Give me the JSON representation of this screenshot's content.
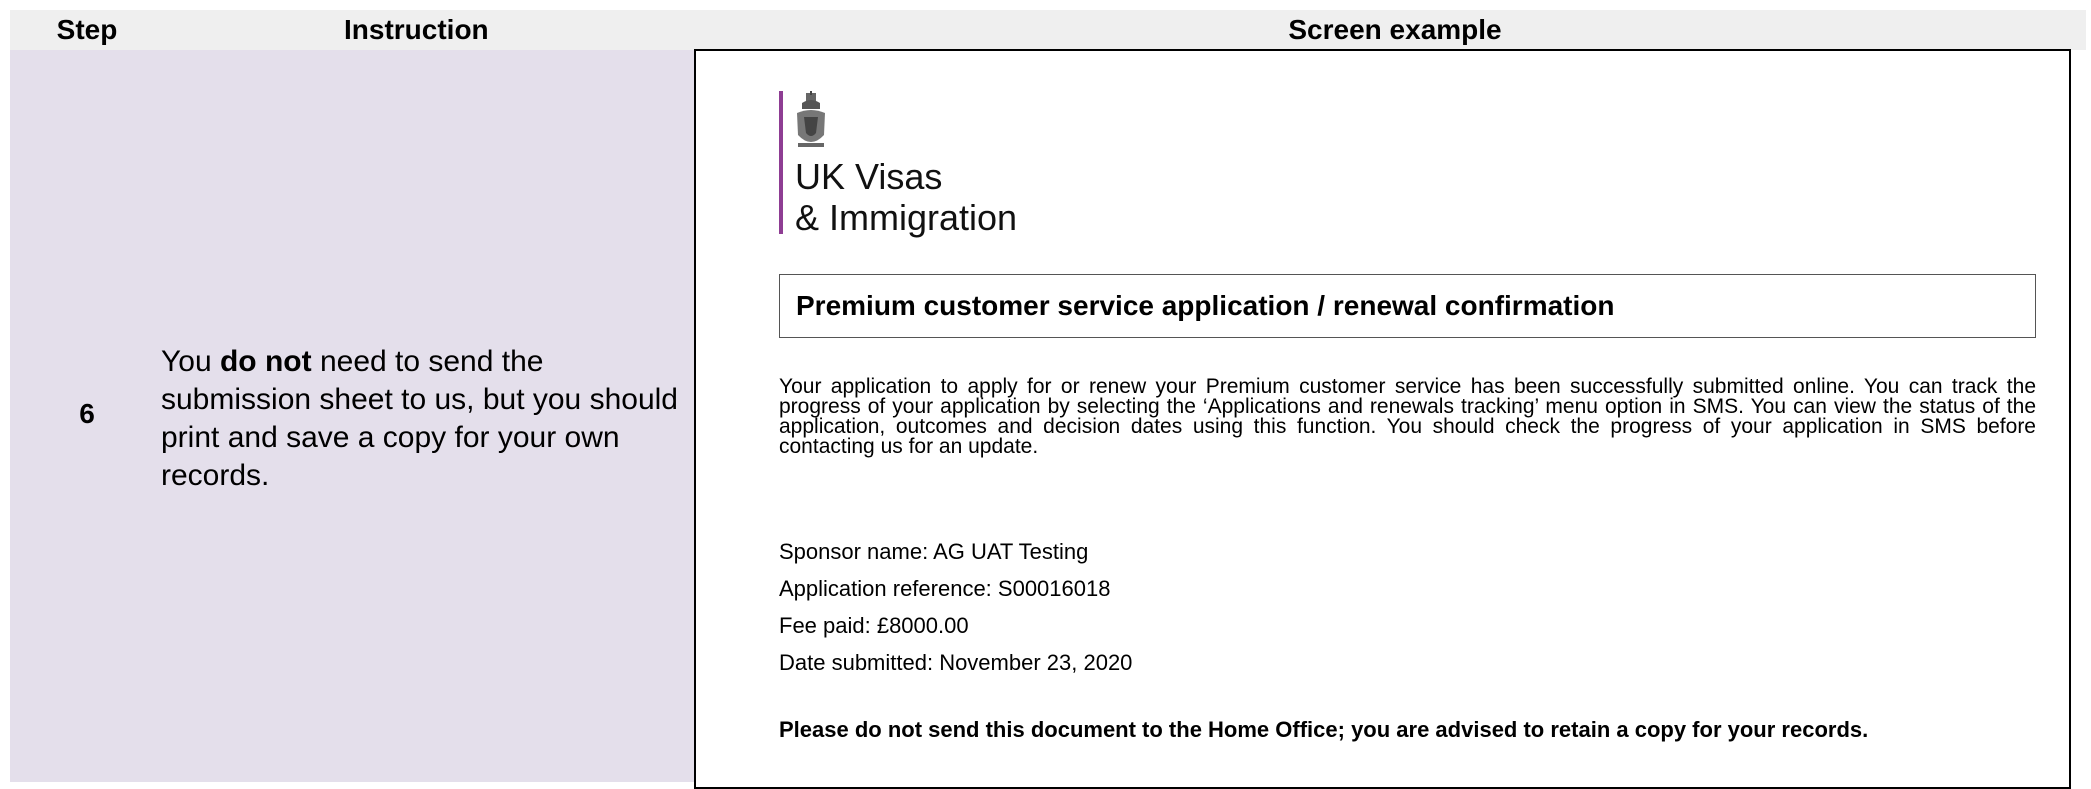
{
  "table": {
    "headers": {
      "step": "Step",
      "instruction": "Instruction",
      "screen": "Screen example"
    },
    "row": {
      "step": "6",
      "instruction_parts": [
        "You ",
        "do not",
        " need to send the submission sheet to us, but you should print and save a copy for your own records."
      ]
    }
  },
  "screen_example": {
    "logo": {
      "line1": "UK Visas",
      "line2": "& Immigration",
      "icon": "royal-crest-icon",
      "accent_color": "#8e3d93"
    },
    "title": "Premium customer service application / renewal confirmation",
    "intro": "Your application to apply for or renew your Premium customer service has been successfully submitted online. You can track the progress of your application by selecting the ‘Applications and renewals tracking’ menu option in SMS. You can view the status of the application, outcomes and decision dates using this function. You should check the progress of your application in SMS before contacting us for an update.",
    "details": [
      "Sponsor name: AG UAT Testing",
      "Application reference: S00016018",
      "Fee paid: £8000.00",
      "Date submitted: November 23, 2020"
    ],
    "advice": "Please do not send this document to the Home Office; you are advised to retain a copy for your records."
  },
  "colors": {
    "header_bg": "#efefef",
    "row_bg": "#e4dfeb"
  }
}
